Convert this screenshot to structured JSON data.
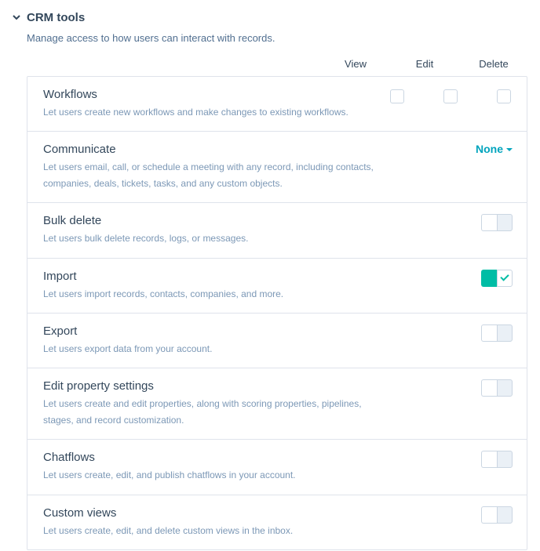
{
  "section": {
    "title": "CRM tools",
    "description": "Manage access to how users can interact with records."
  },
  "columns": {
    "view": "View",
    "edit": "Edit",
    "delete": "Delete"
  },
  "permissions": {
    "workflows": {
      "title": "Workflows",
      "desc": "Let users create new workflows and make changes to existing workflows."
    },
    "communicate": {
      "title": "Communicate",
      "desc": "Let users email, call, or schedule a meeting with any record, including contacts, companies, deals, tickets, tasks, and any custom objects.",
      "dropdown": "None"
    },
    "bulk_delete": {
      "title": "Bulk delete",
      "desc": "Let users bulk delete records, logs, or messages."
    },
    "import": {
      "title": "Import",
      "desc": "Let users import records, contacts, companies, and more."
    },
    "export": {
      "title": "Export",
      "desc": "Let users export data from your account."
    },
    "edit_property": {
      "title": "Edit property settings",
      "desc": "Let users create and edit properties, along with scoring properties, pipelines, stages, and record customization."
    },
    "chatflows": {
      "title": "Chatflows",
      "desc": "Let users create, edit, and publish chatflows in your account."
    },
    "custom_views": {
      "title": "Custom views",
      "desc": "Let users create, edit, and delete custom views in the inbox."
    }
  }
}
